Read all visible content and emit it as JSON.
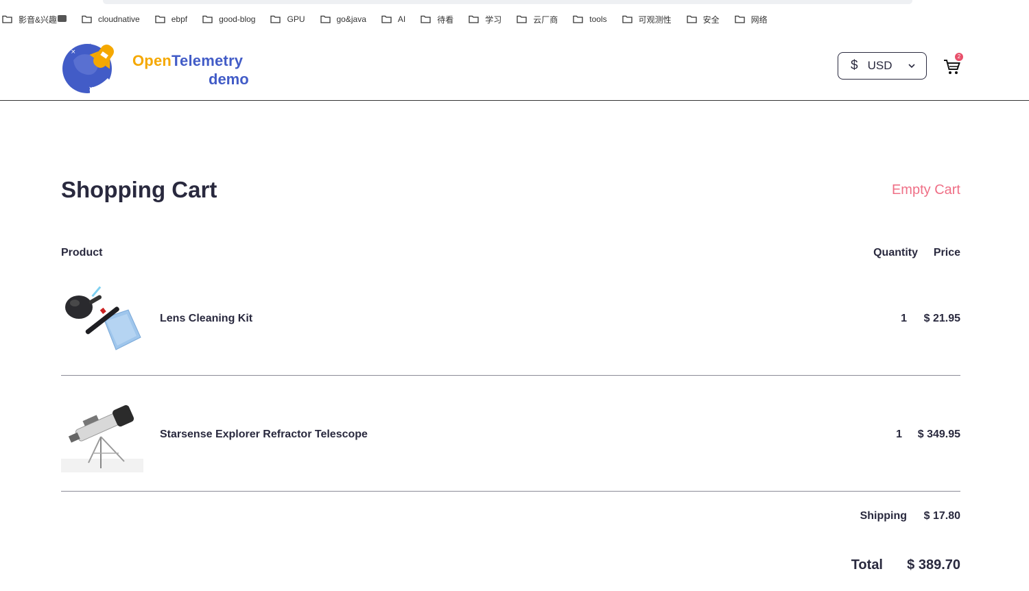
{
  "bookmarks": [
    {
      "label": "影音&兴趣",
      "has_emoji": true
    },
    {
      "label": "cloudnative"
    },
    {
      "label": "ebpf"
    },
    {
      "label": "good-blog"
    },
    {
      "label": "GPU"
    },
    {
      "label": "go&java"
    },
    {
      "label": "AI"
    },
    {
      "label": "待看"
    },
    {
      "label": "学习"
    },
    {
      "label": "云厂商"
    },
    {
      "label": "tools"
    },
    {
      "label": "可观测性"
    },
    {
      "label": "安全"
    },
    {
      "label": "网络"
    }
  ],
  "header": {
    "logo_open": "Open",
    "logo_telemetry": "Telemetry",
    "logo_demo": "demo",
    "currency_symbol": "$",
    "currency_code": "USD",
    "cart_count": "2"
  },
  "cart": {
    "title": "Shopping Cart",
    "empty_label": "Empty Cart",
    "columns": {
      "product": "Product",
      "quantity": "Quantity",
      "price": "Price"
    },
    "items": [
      {
        "name": "Lens Cleaning Kit",
        "quantity": "1",
        "price": "$ 21.95",
        "image_icon": "lens-cleaning-kit-image"
      },
      {
        "name": "Starsense Explorer Refractor Telescope",
        "quantity": "1",
        "price": "$ 349.95",
        "image_icon": "telescope-image"
      }
    ],
    "shipping_label": "Shipping",
    "shipping_value": "$ 17.80",
    "total_label": "Total",
    "total_value": "$ 389.70"
  },
  "colors": {
    "text": "#29293e",
    "logo_orange": "#f5a800",
    "logo_blue": "#425cc7",
    "empty_cart_pink": "#ef6f86",
    "badge": "#e8506b"
  }
}
